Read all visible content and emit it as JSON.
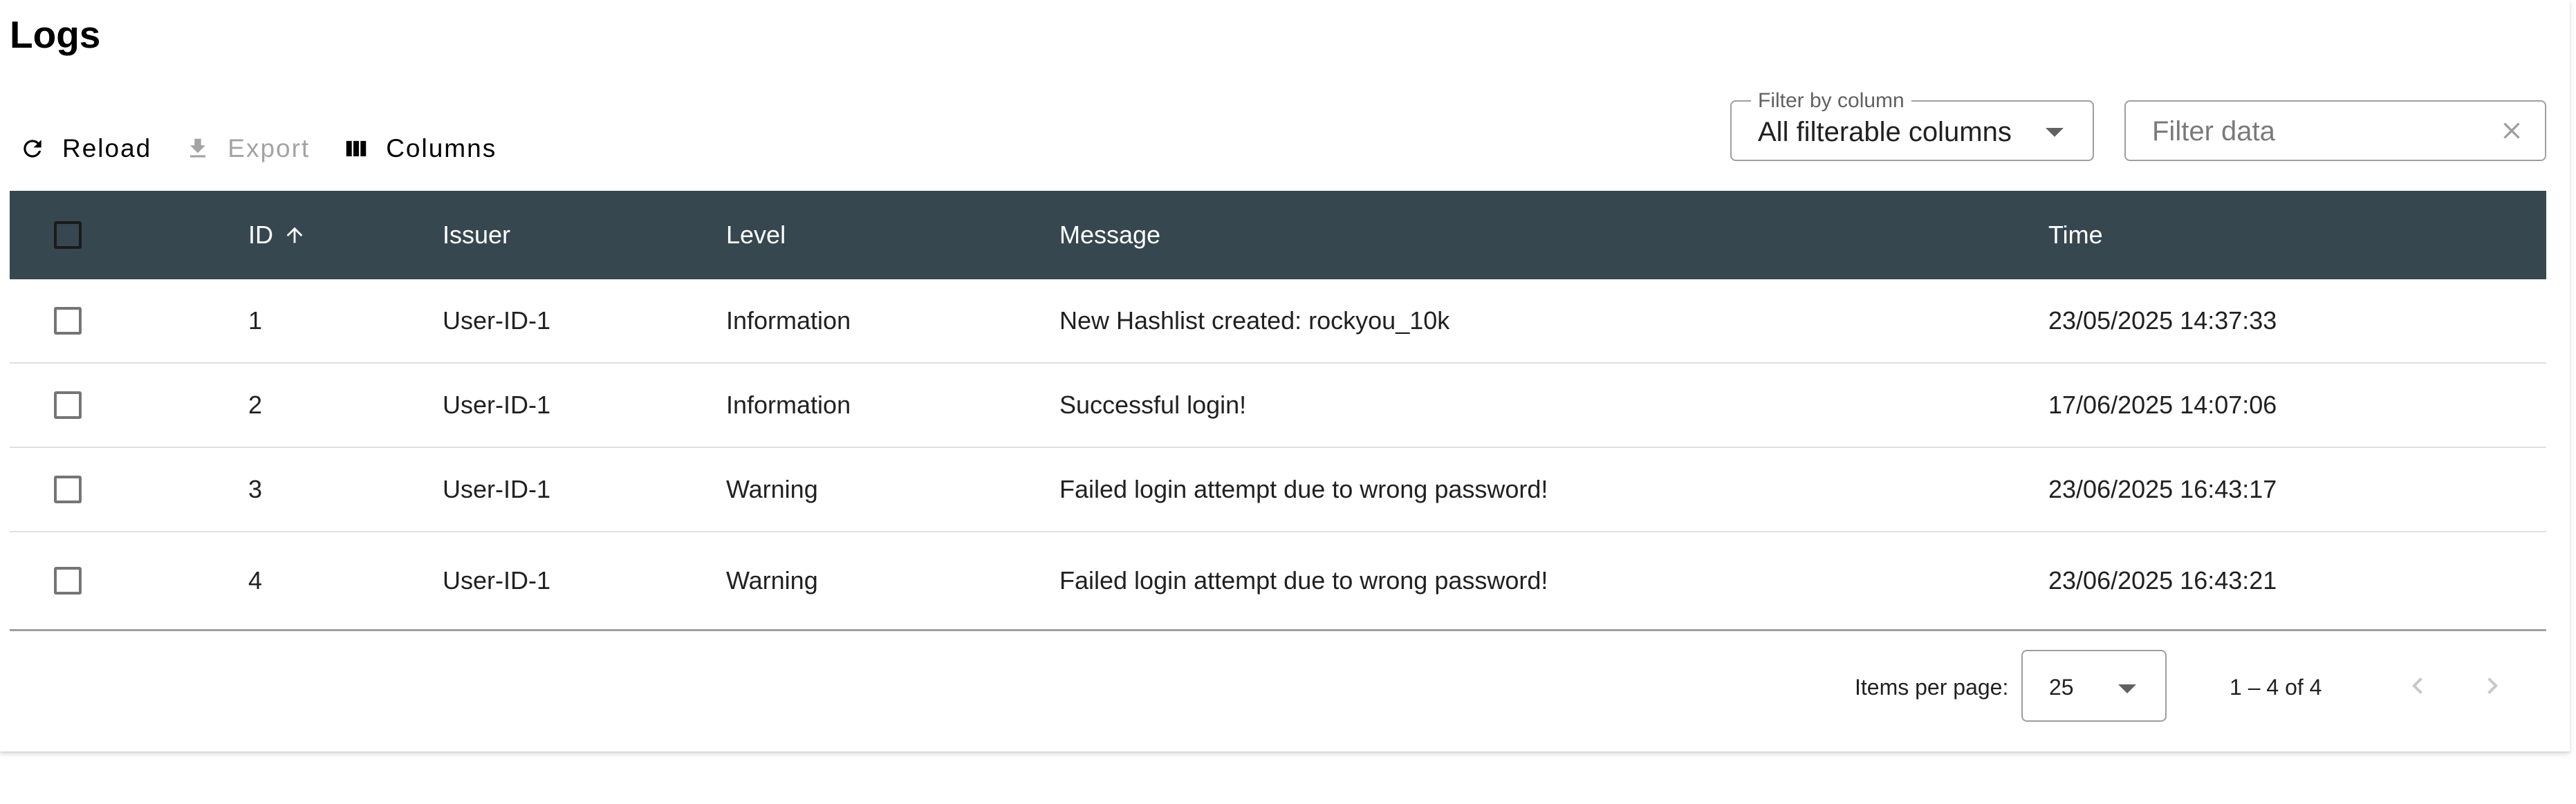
{
  "page": {
    "title": "Logs"
  },
  "toolbar": {
    "reload_label": "Reload",
    "export_label": "Export",
    "columns_label": "Columns"
  },
  "filter": {
    "column_legend": "Filter by column",
    "column_value": "All filterable columns",
    "data_placeholder": "Filter data",
    "data_value": ""
  },
  "table": {
    "headers": {
      "id": "ID",
      "issuer": "Issuer",
      "level": "Level",
      "message": "Message",
      "time": "Time"
    },
    "sort": {
      "column": "ID",
      "direction": "ascending"
    },
    "rows": [
      {
        "id": "1",
        "issuer": "User-ID-1",
        "level": "Information",
        "message": "New Hashlist created: rockyou_10k",
        "time": "23/05/2025 14:37:33"
      },
      {
        "id": "2",
        "issuer": "User-ID-1",
        "level": "Information",
        "message": "Successful login!",
        "time": "17/06/2025 14:07:06"
      },
      {
        "id": "3",
        "issuer": "User-ID-1",
        "level": "Warning",
        "message": "Failed login attempt due to wrong password!",
        "time": "23/06/2025 16:43:17"
      },
      {
        "id": "4",
        "issuer": "User-ID-1",
        "level": "Warning",
        "message": "Failed login attempt due to wrong password!",
        "time": "23/06/2025 16:43:21"
      }
    ]
  },
  "paginator": {
    "items_per_page_label": "Items per page:",
    "items_per_page_value": "25",
    "range_label": "1 – 4 of 4"
  },
  "colors": {
    "header_bg": "#37474f",
    "header_text": "#ffffff",
    "disabled_text": "#a3a3a3"
  }
}
